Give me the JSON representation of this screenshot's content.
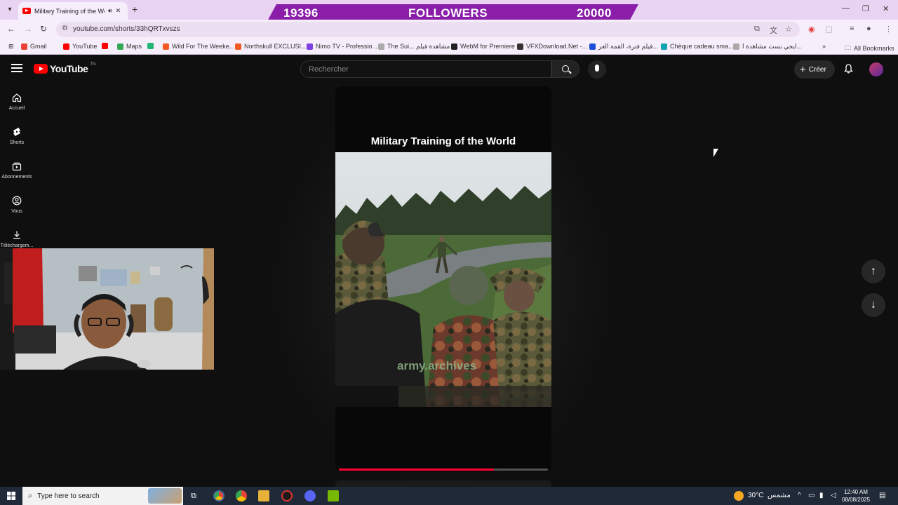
{
  "browser": {
    "tab_title": "Military Training of the World",
    "url": "youtube.com/shorts/33hQRTxvszs",
    "bookmarks": [
      {
        "label": "Gmail",
        "color": "#ea4335"
      },
      {
        "label": "YouTube",
        "color": "#ff0000"
      },
      {
        "label": "",
        "color": "#ff0000"
      },
      {
        "label": "Maps",
        "color": "#34a853"
      },
      {
        "label": "",
        "color": "#22b573"
      },
      {
        "label": "Wild For The Weeke...",
        "color": "#f25a22"
      },
      {
        "label": "Northskull EXCLUSI...",
        "color": "#f25a22"
      },
      {
        "label": "Nimo TV - Professio...",
        "color": "#7b3fe4"
      },
      {
        "label": "The Sui... مشاهدة فيلم",
        "color": "#aaaaaa"
      },
      {
        "label": "WebM for Premiere",
        "color": "#222222"
      },
      {
        "label": "VFXDownload.Net -...",
        "color": "#333333"
      },
      {
        "label": "فيلم فترة، القمة العر...",
        "color": "#1a4fd6"
      },
      {
        "label": "Chèque cadeau sma...",
        "color": "#0fa3b1"
      },
      {
        "label": "ايجي بست مشاهدة ا...",
        "color": "#aaaaaa"
      }
    ],
    "all_bookmarks": "All Bookmarks"
  },
  "overlay": {
    "current": "19396",
    "label": "FOLLOWERS",
    "goal": "20000",
    "color": "#8a1ea8"
  },
  "youtube": {
    "search_placeholder": "Rechercher",
    "create_label": "Créer",
    "sidebar": [
      {
        "label": "Accueil"
      },
      {
        "label": "Shorts"
      },
      {
        "label": "Abonnements"
      },
      {
        "label": "Vous"
      },
      {
        "label": "Téléchargem..."
      }
    ],
    "short": {
      "title": "Military Training of the World",
      "watermark": "army.archives",
      "progress": 0.74
    }
  },
  "taskbar": {
    "search_label": "Type here to search",
    "weather": "30°C",
    "weather_desc": "مشمس",
    "time": "12:40 AM",
    "date": "08/08/2025"
  }
}
